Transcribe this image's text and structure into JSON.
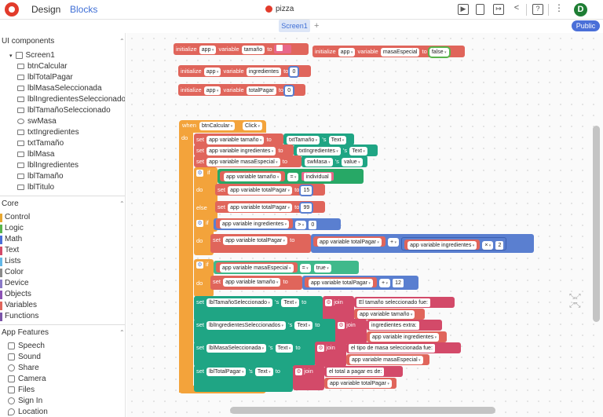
{
  "topbar": {
    "tab_design": "Design",
    "tab_blocks": "Blocks",
    "project_name": "pizza",
    "avatar_letter": "D"
  },
  "screen": {
    "tab": "Screen1",
    "add": "+",
    "public_label": "Public"
  },
  "sidebar": {
    "ui_components_title": "UI components",
    "screen_root": "Screen1",
    "components": [
      "btnCalcular",
      "lblTotalPagar",
      "lblMasaSeleccionada",
      "lblIngredientesSeleccionados",
      "lblTamañoSeleccionado",
      "swMasa",
      "txtIngredientes",
      "txtTamaño",
      "lblMasa",
      "lblIngredientes",
      "lblTamaño",
      "lblTitulo"
    ],
    "core_title": "Core",
    "core_items": [
      {
        "label": "Control",
        "color": "#e7a630"
      },
      {
        "label": "Logic",
        "color": "#59b44c"
      },
      {
        "label": "Math",
        "color": "#4a6fd8"
      },
      {
        "label": "Text",
        "color": "#d34a69"
      },
      {
        "label": "Lists",
        "color": "#63b8e8"
      },
      {
        "label": "Color",
        "color": "#8a8a8a"
      },
      {
        "label": "Device",
        "color": "#8a79c8"
      },
      {
        "label": "Objects",
        "color": "#8c52b4"
      },
      {
        "label": "Variables",
        "color": "#e0655b"
      },
      {
        "label": "Functions",
        "color": "#7a54a8"
      }
    ],
    "app_features_title": "App Features",
    "features": [
      {
        "label": "Speech",
        "icon": "speech-icon"
      },
      {
        "label": "Sound",
        "icon": "sound-icon"
      },
      {
        "label": "Share",
        "icon": "share-icon"
      },
      {
        "label": "Camera",
        "icon": "camera-icon"
      },
      {
        "label": "Files",
        "icon": "files-icon"
      },
      {
        "label": "Sign In",
        "icon": "sign-in-icon"
      },
      {
        "label": "Location",
        "icon": "location-icon"
      }
    ]
  },
  "blocks": {
    "init_tamano": {
      "initialize": "initialize",
      "scope": "app",
      "variable": "variable",
      "name": "tamaño",
      "to": "to",
      "value": ""
    },
    "init_masa": {
      "initialize": "initialize",
      "scope": "app",
      "variable": "variable",
      "name": "masaEspecial",
      "to": "to",
      "value": "false"
    },
    "init_ingredientes": {
      "initialize": "initialize",
      "scope": "app",
      "variable": "variable",
      "name": "ingredientes",
      "to": "to",
      "value": "0"
    },
    "init_total": {
      "initialize": "initialize",
      "scope": "app",
      "variable": "variable",
      "name": "totalPagar",
      "to": "to",
      "value": "0"
    },
    "event": {
      "when": "when",
      "component": "btnCalcular",
      "event": "Click",
      "do": "do"
    },
    "set1": {
      "set": "set",
      "target": "app variable tamaño",
      "to": "to",
      "comp": "txtTamaño",
      "dot": "'s",
      "prop": "Text"
    },
    "set2": {
      "set": "set",
      "target": "app variable ingredientes",
      "to": "to",
      "comp": "txtIngredientes",
      "dot": "'s",
      "prop": "Text"
    },
    "set3": {
      "set": "set",
      "target": "app variable masaEspecial",
      "to": "to",
      "comp": "swMasa",
      "dot": "'s",
      "prop": "value"
    },
    "if1": {
      "if": "if",
      "var": "app variable tamaño",
      "op": "=",
      "str": "individual",
      "do": "do",
      "set": "set",
      "target": "app variable totalPagar",
      "to": "to",
      "val": "15",
      "else": "else",
      "else_val": "99"
    },
    "if2": {
      "if": "if",
      "var": "app variable ingredientes",
      "op": ">",
      "val": "0",
      "do": "do",
      "set": "set",
      "target": "app variable totalPagar",
      "to": "to",
      "add_left": "app variable totalPagar",
      "add_op": "+",
      "mul_left": "app variable ingredientes",
      "mul_op": "×",
      "mul_val": "2"
    },
    "if3": {
      "if": "if",
      "var": "app variable masaEspecial",
      "op": "=",
      "val": "true",
      "do": "do",
      "set": "set",
      "target": "app variable tamaño",
      "to": "to",
      "add_left": "app variable totalPagar",
      "add_op": "+",
      "add_val": "12"
    },
    "out1": {
      "set": "set",
      "comp": "lblTamañoSeleccionado",
      "dot": "'s",
      "prop": "Text",
      "to": "to",
      "join": "join",
      "s1": "El tamaño seleccionado fue:",
      "s2": "app variable tamaño"
    },
    "out2": {
      "set": "set",
      "comp": "lblIngredientesSeleccionados",
      "dot": "'s",
      "prop": "Text",
      "to": "to",
      "join": "join",
      "s1": "ingredientes extra:",
      "s2": "app variable ingredientes"
    },
    "out3": {
      "set": "set",
      "comp": "lblMasaSeleccionada",
      "dot": "'s",
      "prop": "Text",
      "to": "to",
      "join": "join",
      "s1": "el tipo de masa seleccionada fue:",
      "s2": "app variable masaEspecial"
    },
    "out4": {
      "set": "set",
      "comp": "lblTotalPagar",
      "dot": "'s",
      "prop": "Text",
      "to": "to",
      "join": "join",
      "s1": "el total a pagar es de:",
      "s2": "app variable totalPagar"
    }
  }
}
